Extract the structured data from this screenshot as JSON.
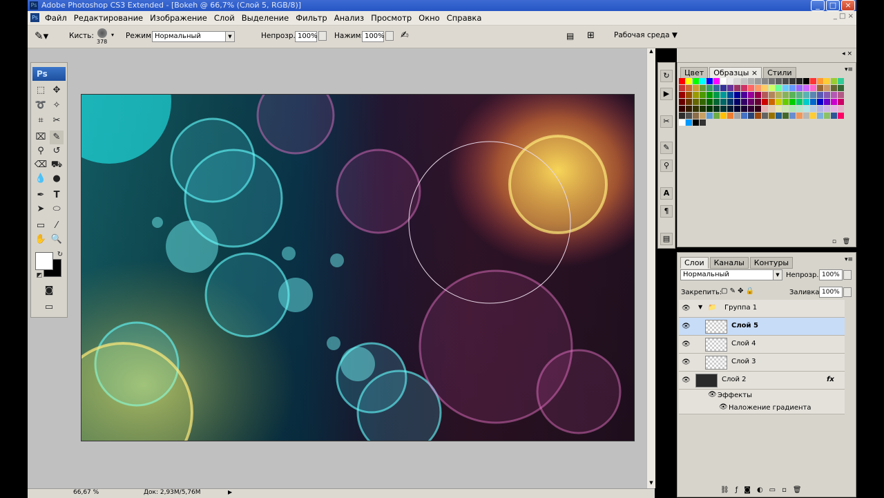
{
  "window": {
    "title": "Adobe Photoshop CS3 Extended - [Bokeh @ 66,7% (Слой 5, RGB/8)]",
    "minimize": "_",
    "maximize": "□",
    "close": "×"
  },
  "menu": [
    "Файл",
    "Редактирование",
    "Изображение",
    "Слой",
    "Выделение",
    "Фильтр",
    "Анализ",
    "Просмотр",
    "Окно",
    "Справка"
  ],
  "options": {
    "brush_label": "Кисть:",
    "brush_size": "378",
    "mode_label": "Режим:",
    "mode_value": "Нормальный",
    "opacity_label": "Непрозр.:",
    "opacity_value": "100%",
    "flow_label": "Нажим:",
    "flow_value": "100%",
    "workspace_label": "Рабочая среда"
  },
  "status": {
    "zoom": "66,67 %",
    "doc": "Док: 2,93M/5,76M"
  },
  "swatches_panel": {
    "tabs": [
      "Цвет",
      "Образцы",
      "Стили"
    ],
    "active_tab": 1,
    "colors": [
      "#ff0000",
      "#ffff00",
      "#00ff00",
      "#00ffff",
      "#0000ff",
      "#ff00ff",
      "#ffffff",
      "#ebebeb",
      "#d7d7d7",
      "#c3c3c3",
      "#afafaf",
      "#9b9b9b",
      "#878787",
      "#737373",
      "#5f5f5f",
      "#4b4b4b",
      "#373737",
      "#232323",
      "#000000",
      "#ff3333",
      "#ff9933",
      "#ffcc33",
      "#99cc33",
      "#33cc99",
      "#cc3333",
      "#cc6633",
      "#cc9933",
      "#669933",
      "#339966",
      "#336699",
      "#333399",
      "#663399",
      "#993366",
      "#cc3366",
      "#ff6666",
      "#ff9966",
      "#ffcc66",
      "#ccff66",
      "#66ff99",
      "#66ccff",
      "#6699ff",
      "#9966ff",
      "#cc66ff",
      "#ff66cc",
      "#996633",
      "#cc9966",
      "#666633",
      "#336633",
      "#990000",
      "#994c00",
      "#999900",
      "#4c9900",
      "#009900",
      "#00994c",
      "#009999",
      "#004c99",
      "#000099",
      "#4c0099",
      "#990099",
      "#99004c",
      "#b35959",
      "#b38659",
      "#b3b359",
      "#86b359",
      "#59b359",
      "#59b386",
      "#59b3b3",
      "#5986b3",
      "#5959b3",
      "#8659b3",
      "#b359b3",
      "#b35986",
      "#660000",
      "#663300",
      "#666600",
      "#336600",
      "#006600",
      "#006633",
      "#006666",
      "#003366",
      "#000066",
      "#330066",
      "#660066",
      "#660033",
      "#cc0000",
      "#cc6600",
      "#cccc00",
      "#66cc00",
      "#00cc00",
      "#00cc66",
      "#00cccc",
      "#0066cc",
      "#0000cc",
      "#6600cc",
      "#cc00cc",
      "#cc0066",
      "#330000",
      "#331a00",
      "#333300",
      "#1a3300",
      "#003300",
      "#00331a",
      "#003333",
      "#001a33",
      "#000033",
      "#1a0033",
      "#330033",
      "#33001a",
      "#e6b3b3",
      "#e6ccb3",
      "#e6e6b3",
      "#cce6b3",
      "#b3e6b3",
      "#b3e6cc",
      "#b3e6e6",
      "#b3cce6",
      "#b3b3e6",
      "#ccb3e6",
      "#e6b3e6",
      "#e6b3cc",
      "#2d2d2d",
      "#505050",
      "#8c6e4b",
      "#c8a064",
      "#5a9bd5",
      "#70ad47",
      "#ffc000",
      "#ed7d31",
      "#a5a5a5",
      "#4472c4",
      "#264478",
      "#9e480e",
      "#636363",
      "#997300",
      "#255e91",
      "#43682b",
      "#698ed0",
      "#f1975a",
      "#b7b7b7",
      "#ffcd33",
      "#7cafdd",
      "#8cc168",
      "#2f5597",
      "#ff0066",
      "#ffffff",
      "#0099ff",
      "#000000",
      "#333333"
    ],
    "new_btn": "▫",
    "delete_btn": "🗑"
  },
  "layers_panel": {
    "tabs": [
      "Слои",
      "Каналы",
      "Контуры"
    ],
    "active_tab": 0,
    "blend_mode": "Нормальный",
    "opacity_label": "Непрозр.:",
    "opacity_value": "100%",
    "lock_label": "Закрепить:",
    "fill_label": "Заливка:",
    "fill_value": "100%",
    "group_name": "Группа 1",
    "layers": [
      "Слой 5",
      "Слой 4",
      "Слой 3"
    ],
    "bottom_layer": "Слой 2",
    "effects_label": "Эффекты",
    "effect_name": "Наложение градиента",
    "fx": "fx"
  },
  "workspace_colors": {
    "canvas_bg": "#c0c0c0",
    "panel_bg": "#d7d4cc",
    "selected_layer": "#c7dcf7"
  }
}
